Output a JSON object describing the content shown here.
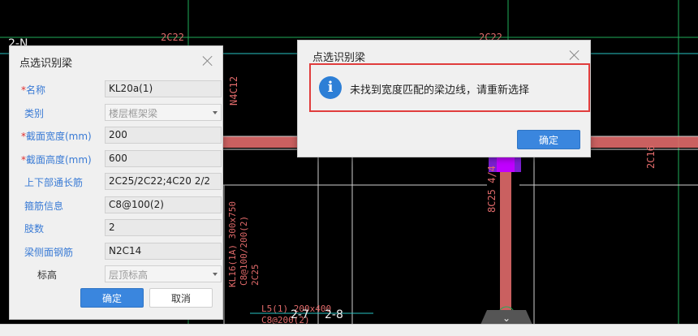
{
  "cad": {
    "labels": {
      "top_left": "2C22",
      "top_right": "2C22",
      "vertical_left": "N4C12",
      "vertical_right": "8C25 4/4",
      "far_right": "2C16",
      "beam_note_1": "KL16(1A) 300x750",
      "beam_note_2": "C8@100/200(2)",
      "beam_note_3": "2C25",
      "bottom_1": "L5(1) 200x400",
      "bottom_2": "C8@200(2)",
      "axis_a": "2-7",
      "axis_b": "2-8",
      "edge_a": "2-N",
      "edge_b": "2-",
      "scroll_icon": "⌄"
    },
    "colors": {
      "beam": "#e06a6a",
      "green": "#1fae5a",
      "cyan": "#27c4c4",
      "purple": "#7b1fd1",
      "magenta": "#c000ff"
    }
  },
  "beam_dialog": {
    "title": "点选识别梁",
    "fields": [
      {
        "label": "名称",
        "required": true,
        "value": "KL20a(1)"
      },
      {
        "label": "类别",
        "required": false,
        "value": "楼层框架梁",
        "combo": true
      },
      {
        "label": "截面宽度(mm)",
        "required": true,
        "value": "200"
      },
      {
        "label": "截面高度(mm)",
        "required": true,
        "value": "600"
      },
      {
        "label": "上下部通长筋",
        "required": false,
        "value": "2C25/2C22;4C20 2/2"
      },
      {
        "label": "箍筋信息",
        "required": false,
        "value": "C8@100(2)"
      },
      {
        "label": "肢数",
        "required": false,
        "value": "2"
      },
      {
        "label": "梁侧面钢筋",
        "required": false,
        "value": "N2C14"
      },
      {
        "label": "标高",
        "required": false,
        "value": "层顶标高",
        "combo": true,
        "plain": true
      }
    ],
    "ok_label": "确定",
    "cancel_label": "取消"
  },
  "message_dialog": {
    "title": "点选识别梁",
    "message": "未找到宽度匹配的梁边线，请重新选择",
    "ok_label": "确定",
    "highlight_color": "#e03c3c"
  },
  "statusbar": {
    "text": "..."
  }
}
